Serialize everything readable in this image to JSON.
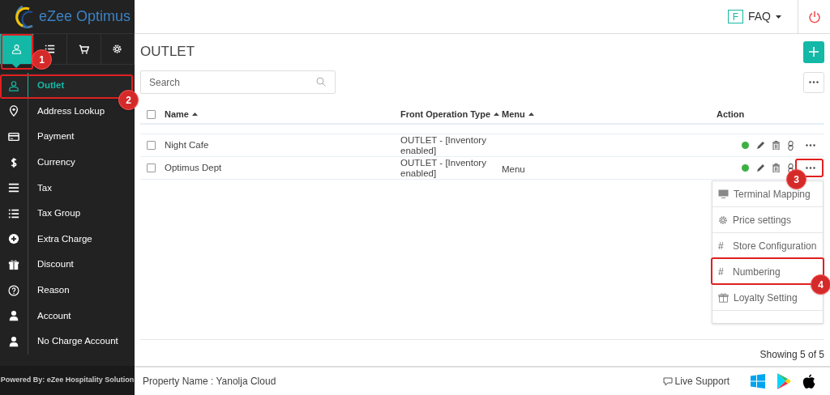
{
  "brand": {
    "name": "eZee Optimus"
  },
  "top_tabs": [
    {
      "selected": true
    },
    {
      "selected": false
    },
    {
      "selected": false
    },
    {
      "selected": false
    }
  ],
  "sidebar": {
    "items": [
      {
        "label": "Outlet",
        "selected": true
      },
      {
        "label": "Address Lookup",
        "selected": false
      },
      {
        "label": "Payment",
        "selected": false
      },
      {
        "label": "Currency",
        "selected": false
      },
      {
        "label": "Tax",
        "selected": false
      },
      {
        "label": "Tax Group",
        "selected": false
      },
      {
        "label": "Extra Charge",
        "selected": false
      },
      {
        "label": "Discount",
        "selected": false
      },
      {
        "label": "Reason",
        "selected": false
      },
      {
        "label": "Account",
        "selected": false
      },
      {
        "label": "No Charge Account",
        "selected": false
      }
    ],
    "footer": "Powered By: eZee Hospitality Solution"
  },
  "header": {
    "faq_badge": "F",
    "faq": "FAQ"
  },
  "page": {
    "title": "OUTLET",
    "search": {
      "placeholder": "Search"
    }
  },
  "table": {
    "select_all": {
      "checked": false
    },
    "columns": [
      {
        "label": "Name",
        "sortable": true
      },
      {
        "label": "Front Operation Type",
        "sortable": true
      },
      {
        "label": "Menu",
        "sortable": true
      },
      {
        "label": "Action",
        "sortable": false
      }
    ],
    "rows": [
      {
        "name": "Night Cafe",
        "type": "OUTLET - [Inventory enabled]",
        "menu": "",
        "active": true,
        "checked": false
      },
      {
        "name": "Optimus Dept",
        "type": "OUTLET - [Inventory enabled]",
        "menu": "Menu",
        "active": true,
        "checked": false
      }
    ]
  },
  "row_menu": {
    "items": [
      {
        "label": "Terminal Mapping"
      },
      {
        "label": "Price settings"
      },
      {
        "symbol": "#",
        "label": "Store Configuration"
      },
      {
        "symbol": "#",
        "label": "Numbering"
      },
      {
        "label": "Loyalty Setting"
      }
    ]
  },
  "showing": "Showing 5 of 5",
  "footer": {
    "property": "Property Name : Yanolja Cloud",
    "live_support": "Live Support"
  },
  "annotations": [
    {
      "number": "1"
    },
    {
      "number": "2"
    },
    {
      "number": "3"
    },
    {
      "number": "4"
    }
  ]
}
